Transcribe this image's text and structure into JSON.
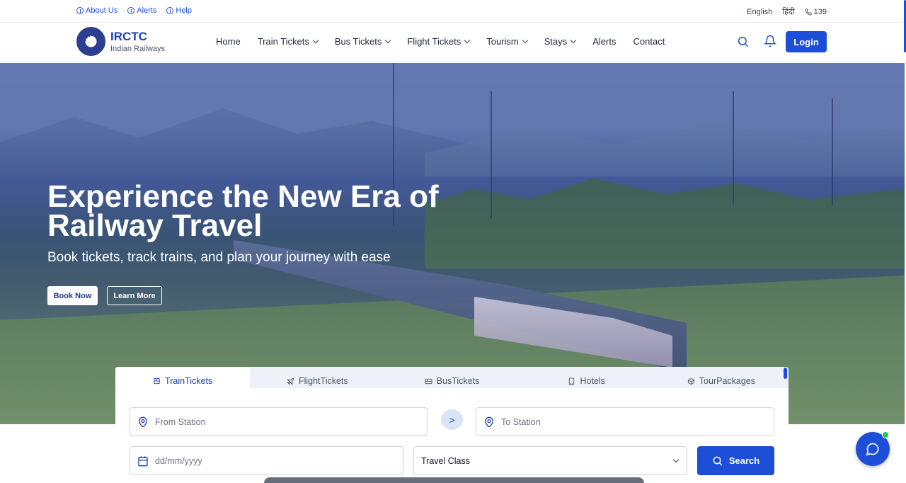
{
  "topbar": {
    "left_links": [
      {
        "label": "About Us"
      },
      {
        "label": "Alerts"
      },
      {
        "label": "Help"
      }
    ],
    "language": "English",
    "hindi": "हिंदी",
    "phone": "139"
  },
  "header": {
    "brand_title": "IRCTC",
    "brand_subtitle": "Indian Railways",
    "nav": [
      {
        "label": "Home",
        "dropdown": false
      },
      {
        "label": "Train Tickets",
        "dropdown": true
      },
      {
        "label": "Bus Tickets",
        "dropdown": true
      },
      {
        "label": "Flight Tickets",
        "dropdown": true
      },
      {
        "label": "Tourism",
        "dropdown": true
      },
      {
        "label": "Stays",
        "dropdown": true
      },
      {
        "label": "Alerts",
        "dropdown": false
      },
      {
        "label": "Contact",
        "dropdown": false
      }
    ],
    "login_label": "Login"
  },
  "hero": {
    "title": "Experience the New Era of Railway Travel",
    "subtitle": "Book tickets, track trains, and plan your journey with ease",
    "book_now_label": "Book Now",
    "learn_more_label": "Learn More"
  },
  "booking": {
    "tabs": [
      {
        "label": "TrainTickets",
        "icon": "train-icon",
        "active": true
      },
      {
        "label": "FlightTickets",
        "icon": "plane-icon",
        "active": false
      },
      {
        "label": "BusTickets",
        "icon": "bus-icon",
        "active": false
      },
      {
        "label": "Hotels",
        "icon": "building-icon",
        "active": false
      },
      {
        "label": "TourPackages",
        "icon": "package-icon",
        "active": false
      }
    ],
    "from_placeholder": "From Station",
    "swap_label": ">",
    "to_placeholder": "To Station",
    "date_placeholder": "dd/mm/yyyy",
    "class_selected": "Travel Class",
    "search_label": "Search"
  },
  "colors": {
    "primary": "#1d4ed8",
    "brand_text": "#1e40af",
    "chat_online": "#22c55e"
  }
}
